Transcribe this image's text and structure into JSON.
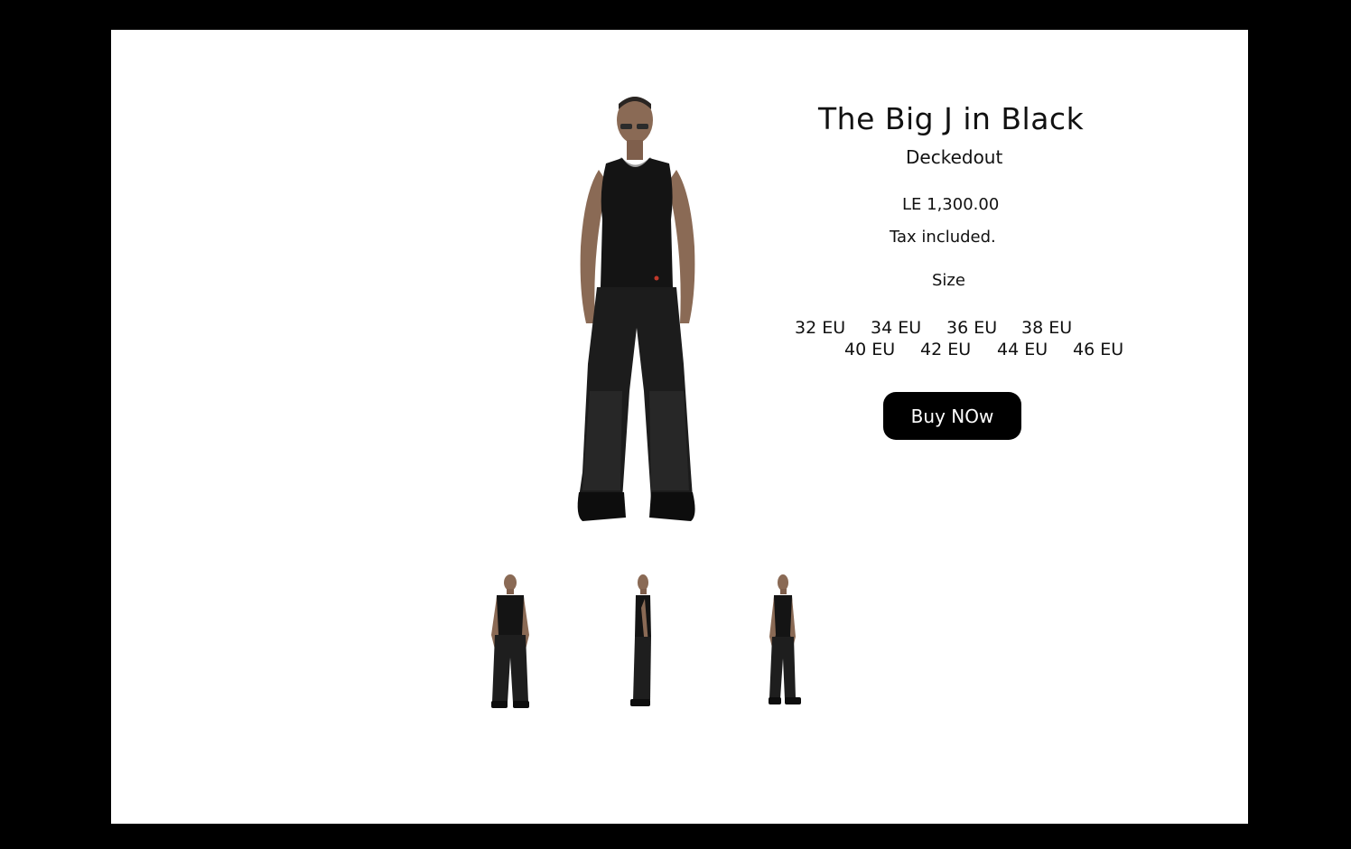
{
  "product": {
    "title": "The Big J in Black",
    "vendor": "Deckedout",
    "price": "LE 1,300.00",
    "tax_note": "Tax included.",
    "size_label": "Size",
    "sizes": [
      "32 EU",
      "34 EU",
      "36 EU",
      "38 EU",
      "40 EU",
      "42 EU",
      "44 EU",
      "46 EU"
    ],
    "buy_label": "Buy NOw"
  },
  "gallery": {
    "main_image": "model-front-view",
    "thumbnails": [
      "model-front-view",
      "model-side-view",
      "model-three-quarter-view"
    ]
  },
  "colors": {
    "background": "#000000",
    "panel": "#ffffff",
    "text": "#111111",
    "button": "#000000",
    "button_text": "#ffffff"
  }
}
